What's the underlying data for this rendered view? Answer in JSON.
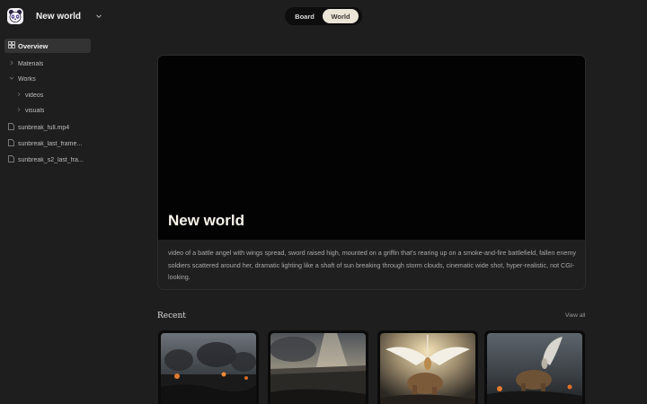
{
  "workspace": {
    "name": "New world",
    "logo_icon": "panda-face-icon"
  },
  "view_toggle": {
    "options": [
      "Board",
      "World"
    ],
    "selected": "World"
  },
  "sidebar": {
    "overview_label": "Overview",
    "items": [
      {
        "label": "Materials",
        "type": "folder",
        "expanded": false
      },
      {
        "label": "Works",
        "type": "folder",
        "expanded": true
      },
      {
        "label": "videos",
        "type": "folder",
        "expanded": false
      },
      {
        "label": "visuals",
        "type": "folder",
        "expanded": false
      },
      {
        "label": "sunbreak_full.mp4",
        "type": "file"
      },
      {
        "label": "sunbreak_last_frame...",
        "type": "file"
      },
      {
        "label": "sunbreak_s2_last_fra...",
        "type": "file"
      }
    ]
  },
  "hero": {
    "title": "New world",
    "description": "video of a battle angel with wings spread, sword raised high, mounted on a griffin that's rearing up on a smoke-and-fire battlefield, fallen enemy soldiers scattered around her, dramatic lighting like a shaft of sun breaking through storm clouds, cinematic wide shot, hyper-realistic, not CGI-looking."
  },
  "recent": {
    "title": "Recent",
    "view_all_label": "View all",
    "items": [
      {
        "kind": "battlefield-smoke"
      },
      {
        "kind": "battlefield-sunrays"
      },
      {
        "kind": "angel-griffin-wings"
      },
      {
        "kind": "angel-griffin-battle"
      }
    ]
  },
  "colors": {
    "background": "#1e1e1e",
    "accent_toggle": "#ebe5d8",
    "sidebar_selected": "#333333"
  }
}
